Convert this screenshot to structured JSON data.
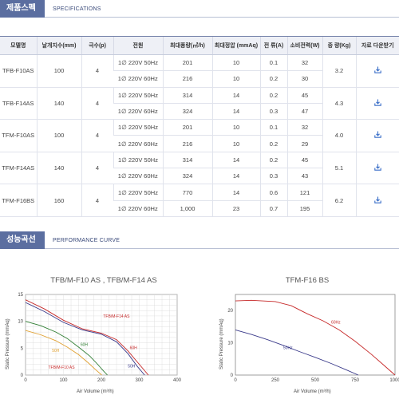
{
  "specs_section": {
    "title_kr": "제품스펙",
    "title_en": "SPECIFICATIONS"
  },
  "table": {
    "headers": [
      "모델명",
      "날개지수(mm)",
      "극수(p)",
      "전원",
      "최대풍량(㎥/h)",
      "최대정압 (mmAq)",
      "전 류(A)",
      "소비전력(W)",
      "중 량(Kg)",
      "자료 다운받기"
    ],
    "models": [
      {
        "name": "TFB-F10AS",
        "size": "100",
        "poles": "4",
        "weight": "3.2",
        "rows": [
          {
            "power": "1∅ 220V 50Hz",
            "flow": "201",
            "pressure": "10",
            "current": "0.1",
            "watt": "32"
          },
          {
            "power": "1∅ 220V 60Hz",
            "flow": "216",
            "pressure": "10",
            "current": "0.2",
            "watt": "30"
          }
        ]
      },
      {
        "name": "TFB-F14AS",
        "size": "140",
        "poles": "4",
        "weight": "4.3",
        "rows": [
          {
            "power": "1∅ 220V 50Hz",
            "flow": "314",
            "pressure": "14",
            "current": "0.2",
            "watt": "45"
          },
          {
            "power": "1∅ 220V 60Hz",
            "flow": "324",
            "pressure": "14",
            "current": "0.3",
            "watt": "47"
          }
        ]
      },
      {
        "name": "TFM-F10AS",
        "size": "100",
        "poles": "4",
        "weight": "4.0",
        "rows": [
          {
            "power": "1∅ 220V 50Hz",
            "flow": "201",
            "pressure": "10",
            "current": "0.1",
            "watt": "32"
          },
          {
            "power": "1∅ 220V 60Hz",
            "flow": "216",
            "pressure": "10",
            "current": "0.2",
            "watt": "29"
          }
        ]
      },
      {
        "name": "TFM-F14AS",
        "size": "140",
        "poles": "4",
        "weight": "5.1",
        "rows": [
          {
            "power": "1∅ 220V 50Hz",
            "flow": "314",
            "pressure": "14",
            "current": "0.2",
            "watt": "45"
          },
          {
            "power": "1∅ 220V 60Hz",
            "flow": "324",
            "pressure": "14",
            "current": "0.3",
            "watt": "43"
          }
        ]
      },
      {
        "name": "TFM-F16BS",
        "size": "160",
        "poles": "4",
        "weight": "6.2",
        "rows": [
          {
            "power": "1∅ 220V 50Hz",
            "flow": "770",
            "pressure": "14",
            "current": "0.6",
            "watt": "121"
          },
          {
            "power": "1∅ 220V 60Hz",
            "flow": "1,000",
            "pressure": "23",
            "current": "0.7",
            "watt": "195"
          }
        ]
      }
    ],
    "download_icon": "download-icon"
  },
  "curve_section": {
    "title_kr": "성능곡선",
    "title_en": "PERFORMANCE CURVE"
  },
  "chart_data": [
    {
      "type": "line",
      "title": "TFB/M-F10 AS , TFB/M-F14 AS",
      "xlabel": "Air Volume (m³/h)",
      "ylabel": "Static Pressure (mmAq)",
      "xlim": [
        0,
        400
      ],
      "ylim": [
        0,
        15
      ],
      "xticks": [
        "0",
        "100",
        "200",
        "300",
        "400"
      ],
      "yticks": [
        "0",
        "5",
        "10",
        "15"
      ],
      "grid": true,
      "series": [
        {
          "name": "60H",
          "color": "#2e7d32",
          "x": [
            0,
            40,
            80,
            110,
            140,
            170,
            190,
            205,
            216
          ],
          "y": [
            10,
            9.2,
            8.0,
            6.8,
            5.2,
            3.5,
            2.0,
            0.8,
            0
          ]
        },
        {
          "name": "50H",
          "color": "#e0a030",
          "x": [
            0,
            40,
            80,
            110,
            140,
            165,
            185,
            201
          ],
          "y": [
            8.3,
            7.5,
            6.4,
            5.2,
            3.8,
            2.3,
            1.0,
            0
          ]
        },
        {
          "name": "60H",
          "color": "#c62828",
          "x": [
            0,
            50,
            100,
            150,
            200,
            240,
            270,
            300,
            324
          ],
          "y": [
            14,
            12.3,
            10.2,
            8.6,
            7.8,
            6.6,
            4.5,
            2.0,
            0
          ]
        },
        {
          "name": "50H",
          "color": "#3a3a8a",
          "x": [
            0,
            50,
            100,
            150,
            200,
            240,
            270,
            295,
            314
          ],
          "y": [
            13.5,
            11.8,
            9.8,
            8.4,
            7.6,
            6.2,
            4.0,
            1.6,
            0
          ]
        }
      ],
      "annotations": [
        {
          "text": "TFB/M-F14 AS",
          "color": "#c62828",
          "x": 205,
          "y": 10.7
        },
        {
          "text": "TFB/M-F10 AS",
          "color": "#c62828",
          "x": 60,
          "y": 1.2
        },
        {
          "text": "60H",
          "color": "#2e7d32",
          "x": 145,
          "y": 5.4
        },
        {
          "text": "50H",
          "color": "#e0a030",
          "x": 70,
          "y": 4.3
        },
        {
          "text": "60H",
          "color": "#c62828",
          "x": 275,
          "y": 4.8
        },
        {
          "text": "50H",
          "color": "#3a3a8a",
          "x": 270,
          "y": 1.4
        }
      ]
    },
    {
      "type": "line",
      "title": "TFM-F16 BS",
      "xlabel": "Air Volume (m³/h)",
      "ylabel": "Static Pressure (mmAq)",
      "xlim": [
        0,
        1000
      ],
      "ylim": [
        0,
        25
      ],
      "xticks": [
        "0",
        "250",
        "500",
        "750",
        "1000"
      ],
      "yticks": [
        "0",
        "10",
        "20"
      ],
      "grid": false,
      "series": [
        {
          "name": "60Hz",
          "color": "#c62828",
          "x": [
            0,
            100,
            250,
            350,
            450,
            550,
            650,
            750,
            850,
            920,
            1000
          ],
          "y": [
            23,
            23.2,
            22.8,
            21.5,
            19,
            16.8,
            14,
            10.5,
            6.5,
            3.5,
            0
          ]
        },
        {
          "name": "50Hz",
          "color": "#3a3a8a",
          "x": [
            0,
            100,
            200,
            300,
            400,
            500,
            600,
            700,
            770
          ],
          "y": [
            14,
            12.6,
            11,
            9.2,
            7.3,
            5.5,
            3.6,
            1.5,
            0
          ]
        }
      ],
      "annotations": [
        {
          "text": "60Hz",
          "color": "#c62828",
          "x": 600,
          "y": 16
        },
        {
          "text": "50Hz",
          "color": "#3a3a8a",
          "x": 300,
          "y": 8
        }
      ]
    }
  ]
}
